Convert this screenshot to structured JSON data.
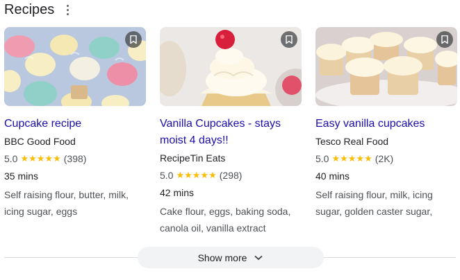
{
  "header": {
    "title": "Recipes",
    "menu_icon": "more-vert-icon"
  },
  "cards": [
    {
      "title": "Cupcake recipe",
      "source": "BBC Good Food",
      "rating": "5.0",
      "stars": "★★★★★",
      "reviews": "(398)",
      "time": "35 mins",
      "ingredients": "Self raising flour, butter, milk, icing sugar, eggs",
      "image": "colorful-cupcakes-image",
      "bookmark_icon": "bookmark-icon"
    },
    {
      "title": "Vanilla Cupcakes - stays moist 4 days!!",
      "source": "RecipeTin Eats",
      "rating": "5.0",
      "stars": "★★★★★",
      "reviews": "(298)",
      "time": "42 mins",
      "ingredients": "Cake flour, eggs, baking soda, canola oil, vanilla extract",
      "image": "vanilla-cupcake-raspberry-image",
      "bookmark_icon": "bookmark-icon"
    },
    {
      "title": "Easy vanilla cupcakes",
      "source": "Tesco Real Food",
      "rating": "5.0",
      "stars": "★★★★★",
      "reviews": "(2K)",
      "time": "40 mins",
      "ingredients": "Self raising flour, milk, icing sugar, golden caster sugar,",
      "image": "vanilla-cupcakes-stand-image",
      "bookmark_icon": "bookmark-icon"
    }
  ],
  "show_more": {
    "label": "Show more",
    "icon": "chevron-down-icon"
  },
  "colors": {
    "link": "#1a0dab",
    "star": "#fbbc04",
    "meta": "#4d5156",
    "pill": "#f1f3f4"
  }
}
